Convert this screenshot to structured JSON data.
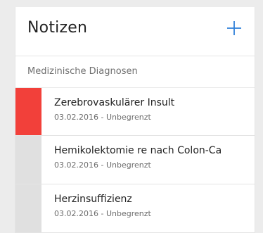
{
  "header": {
    "title": "Notizen",
    "add_icon": "plus-icon",
    "accent_color": "#2f80d9"
  },
  "section": {
    "label": "Medizinische Diagnosen"
  },
  "items": [
    {
      "name": "Zerebrovaskulärer Insult",
      "date": "03.02.2016 - Unbegrenzt",
      "bar_color": "#f2403a"
    },
    {
      "name": "Hemikolektomie re nach Colon-Ca",
      "date": "03.02.2016 - Unbegrenzt",
      "bar_color": "#e0e0e0"
    },
    {
      "name": "Herzinsuffizienz",
      "date": "03.02.2016 - Unbegrenzt",
      "bar_color": "#e0e0e0"
    }
  ]
}
